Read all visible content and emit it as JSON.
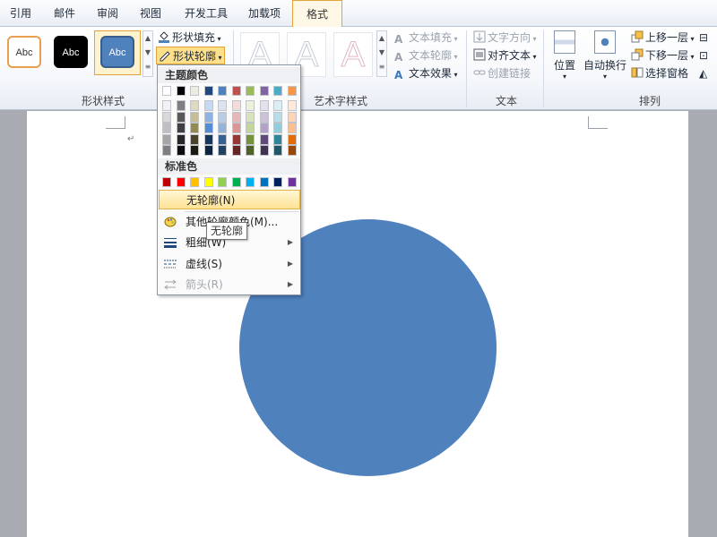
{
  "tabs": [
    {
      "label": "引用",
      "active": false
    },
    {
      "label": "邮件",
      "active": false
    },
    {
      "label": "审阅",
      "active": false
    },
    {
      "label": "视图",
      "active": false
    },
    {
      "label": "开发工具",
      "active": false
    },
    {
      "label": "加载项",
      "active": false
    },
    {
      "label": "格式",
      "active": true
    }
  ],
  "ribbon": {
    "shape_styles": {
      "label": "形状样式",
      "thumbs": [
        "Abc",
        "Abc",
        "Abc"
      ],
      "fill": "形状填充",
      "outline": "形状轮廓"
    },
    "wordart": {
      "label": "艺术字样式",
      "letter": "A",
      "text_fill": "文本填充",
      "text_outline": "文本轮廓",
      "text_effect": "文本效果"
    },
    "text": {
      "label": "文本",
      "direction": "文字方向",
      "align": "对齐文本",
      "link": "创建链接"
    },
    "arrange": {
      "label": "排列",
      "position": "位置",
      "wrap": "自动换行",
      "bring_forward": "上移一层",
      "send_backward": "下移一层",
      "selection_pane": "选择窗格"
    }
  },
  "menu": {
    "theme_colors_title": "主题颜色",
    "standard_colors_title": "标准色",
    "theme_top": [
      "#ffffff",
      "#000000",
      "#eeece1",
      "#1f497d",
      "#4f81bd",
      "#c0504d",
      "#9bbb59",
      "#8064a2",
      "#4bacc6",
      "#f79646"
    ],
    "theme_shades": [
      [
        "#f2f2f2",
        "#7f7f7f",
        "#ddd9c3",
        "#c6d9f0",
        "#dbe5f1",
        "#f2dcdb",
        "#ebf1dd",
        "#e5e0ec",
        "#dbeef3",
        "#fdeada"
      ],
      [
        "#d8d8d8",
        "#595959",
        "#c4bd97",
        "#8db3e2",
        "#b8cce4",
        "#e5b9b7",
        "#d7e3bc",
        "#ccc1d9",
        "#b7dde8",
        "#fbd5b5"
      ],
      [
        "#bfbfbf",
        "#3f3f3f",
        "#938953",
        "#548dd4",
        "#95b3d7",
        "#d99694",
        "#c3d69b",
        "#b2a2c7",
        "#92cddc",
        "#fac08f"
      ],
      [
        "#a5a5a5",
        "#262626",
        "#494429",
        "#17365d",
        "#366092",
        "#953734",
        "#76923c",
        "#5f497a",
        "#31859b",
        "#e36c09"
      ],
      [
        "#7f7f7f",
        "#0c0c0c",
        "#1d1b10",
        "#0f243e",
        "#244061",
        "#632423",
        "#4f6128",
        "#3f3151",
        "#205867",
        "#974806"
      ]
    ],
    "standard": [
      "#c00000",
      "#ff0000",
      "#ffc000",
      "#ffff00",
      "#92d050",
      "#00b050",
      "#00b0f0",
      "#0070c0",
      "#002060",
      "#7030a0"
    ],
    "no_outline": "无轮廓(N)",
    "more_colors": "其他轮廓颜色(M)...",
    "weight": "粗细(W)",
    "dashes": "虚线(S)",
    "arrows": "箭头(R)"
  },
  "tooltip": "无轮廓",
  "document": {
    "paragraph_mark": "↵",
    "shape_color": "#4f81bd"
  }
}
